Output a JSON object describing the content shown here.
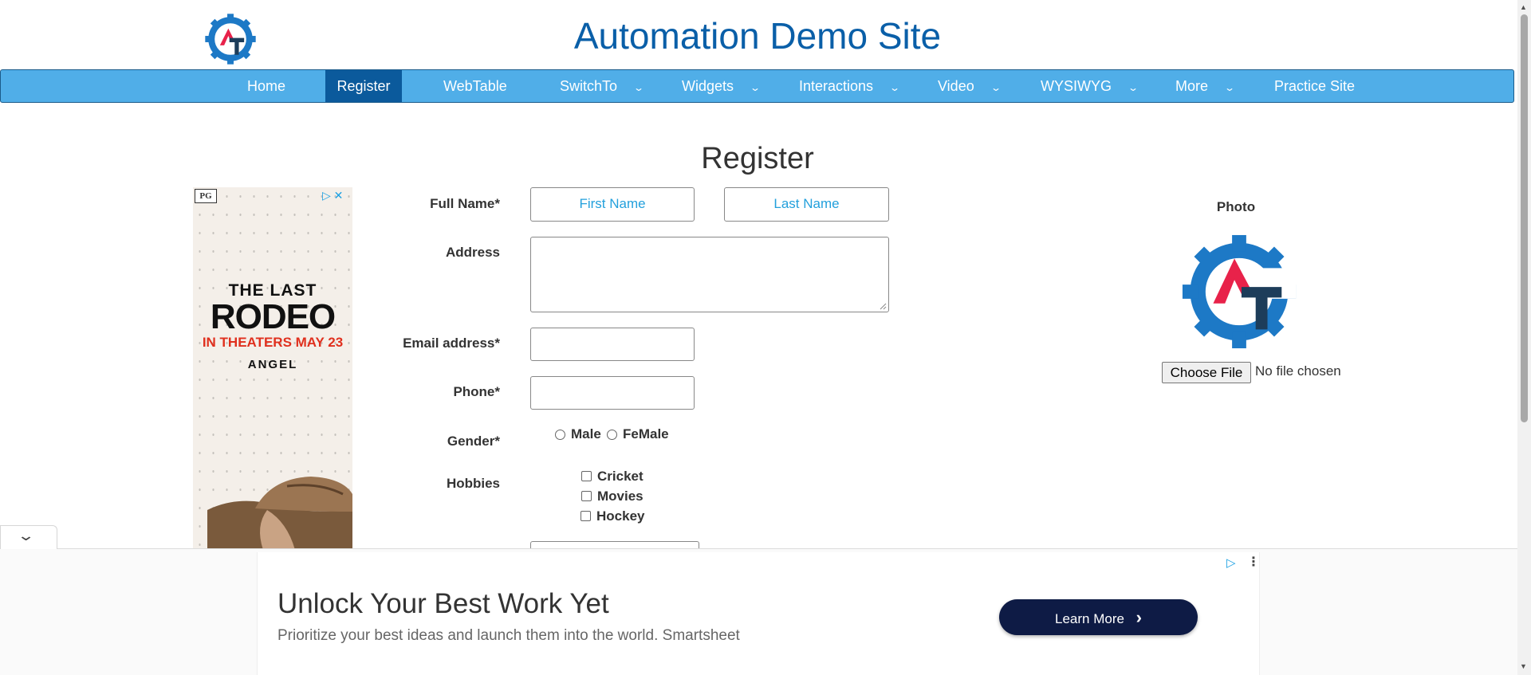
{
  "header": {
    "title": "Automation Demo Site"
  },
  "nav": {
    "items": [
      {
        "label": "Home",
        "dropdown": false,
        "active": false
      },
      {
        "label": "Register",
        "dropdown": false,
        "active": true
      },
      {
        "label": "WebTable",
        "dropdown": false,
        "active": false
      },
      {
        "label": "SwitchTo",
        "dropdown": true,
        "active": false
      },
      {
        "label": "Widgets",
        "dropdown": true,
        "active": false
      },
      {
        "label": "Interactions",
        "dropdown": true,
        "active": false
      },
      {
        "label": "Video",
        "dropdown": true,
        "active": false
      },
      {
        "label": "WYSIWYG",
        "dropdown": true,
        "active": false
      },
      {
        "label": "More",
        "dropdown": true,
        "active": false
      },
      {
        "label": "Practice Site",
        "dropdown": false,
        "active": false
      }
    ],
    "chevron": "⌄"
  },
  "form": {
    "title": "Register",
    "full_name_label": "Full Name*",
    "first_name_placeholder": "First Name",
    "last_name_placeholder": "Last Name",
    "address_label": "Address",
    "email_label": "Email address*",
    "phone_label": "Phone*",
    "gender_label": "Gender*",
    "gender_options": [
      "Male",
      "FeMale"
    ],
    "hobbies_label": "Hobbies",
    "hobbies": [
      "Cricket",
      "Movies",
      "Hockey"
    ]
  },
  "photo": {
    "label": "Photo",
    "choose_file": "Choose File",
    "file_status": "No file chosen"
  },
  "side_ad": {
    "rating": "PG",
    "line1": "THE LAST",
    "line2": "RODEO",
    "line3": "IN THEATERS MAY 23",
    "line4": "ANGEL"
  },
  "bottom_ad": {
    "headline": "Unlock Your Best Work Yet",
    "subtext": "Prioritize your best ideas and launch them into the world. Smartsheet",
    "button": "Learn More",
    "button_arrow": "›"
  },
  "colors": {
    "title_blue": "#0a5fa8",
    "nav_bg": "#50aee8",
    "nav_active": "#0b5a9c",
    "placeholder_blue": "#23a0dc",
    "logo_blue": "#1d79c6",
    "logo_red": "#e8224a",
    "logo_navy": "#1d3d5a",
    "cta_navy": "#0e1b45"
  },
  "icons": {
    "logo": "gear-logo-icon",
    "adchoices": "adchoices-icon",
    "collapse": "chevron-down-icon"
  }
}
